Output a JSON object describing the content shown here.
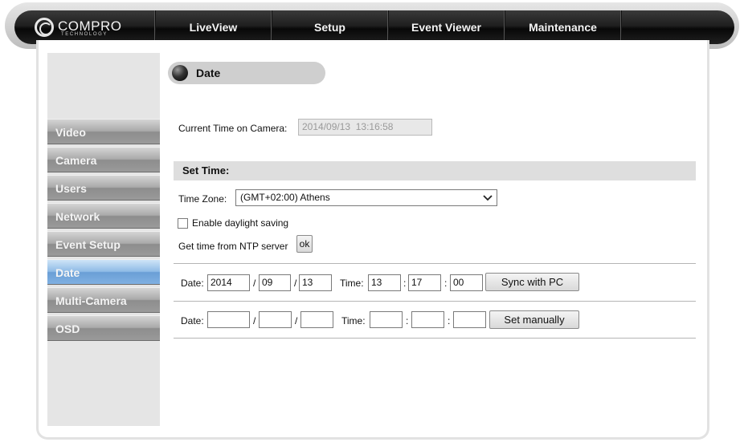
{
  "brand": {
    "name": "COMPRO",
    "sub": "TECHNOLOGY"
  },
  "nav": {
    "items": [
      "LiveView",
      "Setup",
      "Event Viewer",
      "Maintenance"
    ]
  },
  "sidebar": {
    "items": [
      {
        "label": "Video",
        "active": false
      },
      {
        "label": "Camera",
        "active": false
      },
      {
        "label": "Users",
        "active": false
      },
      {
        "label": "Network",
        "active": false
      },
      {
        "label": "Event Setup",
        "active": false
      },
      {
        "label": "Date",
        "active": true
      },
      {
        "label": "Multi-Camera",
        "active": false
      },
      {
        "label": "OSD",
        "active": false
      }
    ]
  },
  "page": {
    "title": "Date",
    "current_time_label": "Current Time on Camera:",
    "current_time_value": "2014/09/13  13:16:58",
    "set_time_heading": "Set Time:",
    "time_zone_label": "Time Zone:",
    "time_zone_value": "(GMT+02:00) Athens",
    "daylight_label": "Enable daylight saving",
    "daylight_checked": false,
    "ntp_label": "Get time from NTP server",
    "ntp_button": "ok"
  },
  "sync_row": {
    "date_label": "Date:",
    "year": "2014",
    "month": "09",
    "day": "13",
    "date_sep": "/",
    "time_label": "Time:",
    "hour": "13",
    "minute": "17",
    "second": "00",
    "time_sep": ":",
    "button": "Sync with PC"
  },
  "manual_row": {
    "date_label": "Date:",
    "year": "",
    "month": "",
    "day": "",
    "date_sep": "/",
    "time_label": "Time:",
    "hour": "",
    "minute": "",
    "second": "",
    "time_sep": ":",
    "button": "Set manually"
  },
  "colors": {
    "nav_bg": "#1a1a1a",
    "active_tab": "#7fb0e2",
    "band": "#dedede"
  }
}
